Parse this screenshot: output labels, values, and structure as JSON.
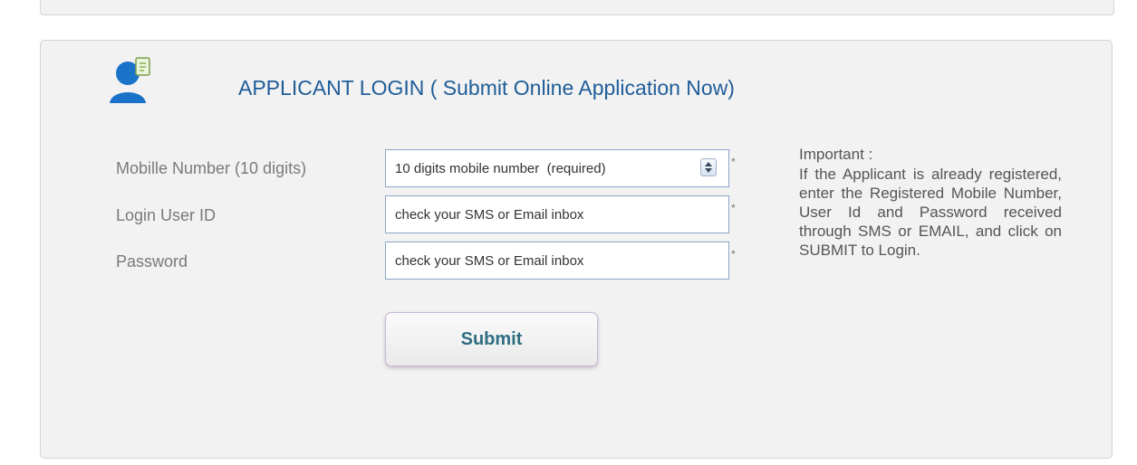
{
  "login": {
    "title": "APPLICANT LOGIN ( Submit Online Application Now)",
    "fields": {
      "mobile": {
        "label": "Mobille Number (10 digits)",
        "placeholder": "10 digits mobile number  (required)"
      },
      "userid": {
        "label": "Login User ID",
        "placeholder": "check your SMS or Email inbox"
      },
      "password": {
        "label": "Password",
        "placeholder": "check your SMS or Email inbox"
      }
    },
    "required_mark": "*",
    "submit_label": "Submit"
  },
  "info": {
    "heading": "Important :",
    "body": "If the Applicant is already registered, enter the Registered Mobile Number, User Id and Password received through SMS or EMAIL, and click on SUBMIT to Login."
  },
  "colors": {
    "title": "#1f5d98",
    "icon": "#1a73c9",
    "panel_bg": "#f2f2f2"
  },
  "icons": {
    "applicant": "user-document-icon",
    "spinner": "number-spinner-icon"
  }
}
